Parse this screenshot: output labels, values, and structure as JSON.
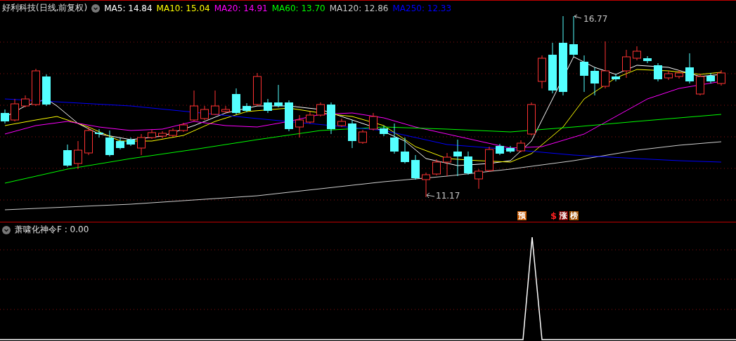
{
  "price_panel": {
    "title": "好利科技(日线,前复权)",
    "indicators": [
      {
        "text": "MA5: 14.84",
        "color": "#ffffff"
      },
      {
        "text": "MA10: 15.04",
        "color": "#ffff00"
      },
      {
        "text": "MA20: 14.91",
        "color": "#ff00ff"
      },
      {
        "text": "MA60: 13.70",
        "color": "#00ff00"
      },
      {
        "text": "MA120: 12.86",
        "color": "#c8c8c8"
      },
      {
        "text": "MA250: 12.33",
        "color": "#0000ff"
      }
    ],
    "high_label": "16.77",
    "low_label": "11.17",
    "markers": [
      {
        "text": "预",
        "kind": "badge",
        "color": "#c85a00"
      },
      {
        "text": "$",
        "kind": "glyph",
        "color": "#ff2020"
      },
      {
        "text": "涨",
        "kind": "badge",
        "color": "#800000"
      },
      {
        "text": "榜",
        "kind": "badge",
        "color": "#a05000"
      }
    ]
  },
  "indicator_panel": {
    "title": "萧啸化神令F : 0.00"
  }
}
